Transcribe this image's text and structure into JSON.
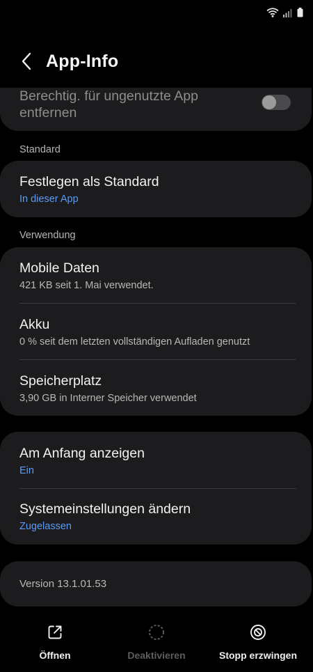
{
  "app_bar": {
    "title": "App-Info"
  },
  "remove_permissions": {
    "label": "Berechtig. für ungenutzte App entfernen",
    "enabled": false
  },
  "standard_section": {
    "label": "Standard",
    "set_default": {
      "title": "Festlegen als Standard",
      "subtitle": "In dieser App"
    }
  },
  "usage_section": {
    "label": "Verwendung",
    "items": [
      {
        "title": "Mobile Daten",
        "subtitle": "421 KB seit 1. Mai verwendet."
      },
      {
        "title": "Akku",
        "subtitle": "0 % seit dem letzten vollständigen Aufladen genutzt"
      },
      {
        "title": "Speicherplatz",
        "subtitle": "3,90 GB in Interner Speicher verwendet"
      }
    ]
  },
  "advanced_section": {
    "items": [
      {
        "title": "Am Anfang anzeigen",
        "subtitle": "Ein"
      },
      {
        "title": "Systemeinstellungen ändern",
        "subtitle": "Zugelassen"
      }
    ]
  },
  "version": {
    "text": "Version 13.1.01.53"
  },
  "bottom_nav": {
    "open": {
      "label": "Öffnen",
      "icon": "open-external-icon"
    },
    "disable": {
      "label": "Deaktivieren",
      "icon": "disable-circle-icon",
      "enabled": false
    },
    "force_stop": {
      "label": "Stopp erzwingen",
      "icon": "force-stop-icon"
    }
  },
  "colors": {
    "background": "#000000",
    "card": "#1c1c1e",
    "accent_blue": "#5b9bf5",
    "secondary_text": "#b8b8b8",
    "disabled_text": "#5e5e5e"
  }
}
